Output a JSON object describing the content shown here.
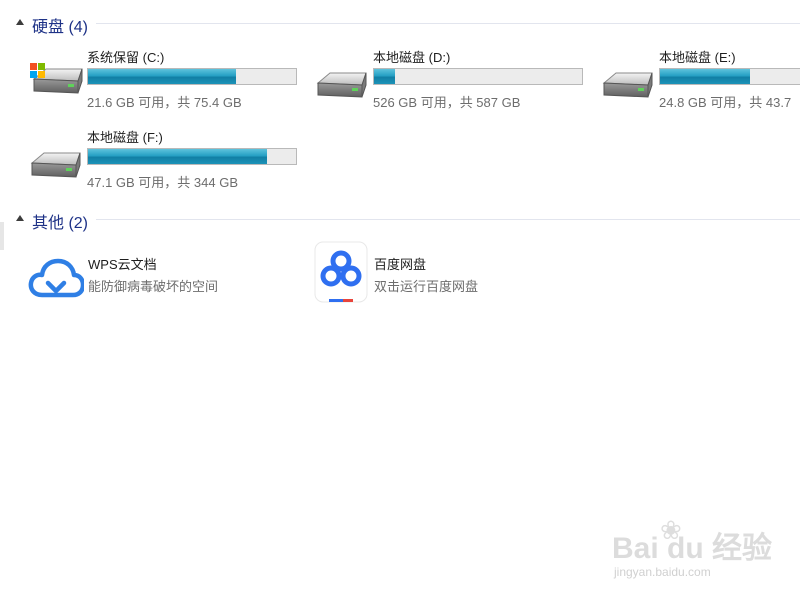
{
  "groups": {
    "drives": {
      "title": "硬盘 (4)",
      "items": [
        {
          "name": "系统保留 (C:)",
          "free": "21.6 GB 可用，共 75.4 GB",
          "used_fraction": 0.71,
          "icon": "system-drive-icon"
        },
        {
          "name": "本地磁盘 (D:)",
          "free": "526 GB 可用，共 587 GB",
          "used_fraction": 0.1,
          "icon": "hard-drive-icon"
        },
        {
          "name": "本地磁盘 (E:)",
          "free": "24.8 GB 可用，共 43.7",
          "used_fraction": 0.43,
          "icon": "hard-drive-icon"
        },
        {
          "name": "本地磁盘 (F:)",
          "free": "47.1 GB 可用，共 344 GB",
          "used_fraction": 0.86,
          "icon": "hard-drive-icon"
        }
      ]
    },
    "others": {
      "title": "其他 (2)",
      "items": [
        {
          "name": "WPS云文档",
          "desc": "能防御病毒破坏的空间",
          "icon": "wps-cloud-icon"
        },
        {
          "name": "百度网盘",
          "desc": "双击运行百度网盘",
          "icon": "baidu-netdisk-icon"
        }
      ]
    }
  },
  "watermark": {
    "brand": "Bai du 经验",
    "site": "jingyan.baidu.com"
  },
  "colors": {
    "group_title": "#1e3287",
    "bar_fill": "#26a0c4",
    "wps_blue": "#2f7fe5",
    "baidu_blue": "#2f6ff0"
  }
}
